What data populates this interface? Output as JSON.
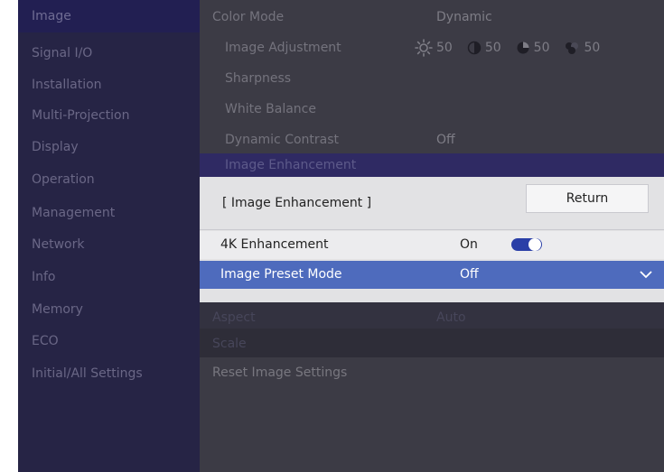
{
  "sidebar": {
    "items": [
      {
        "label": "Image"
      },
      {
        "label": "Signal I/O"
      },
      {
        "label": "Installation"
      },
      {
        "label": "Multi-Projection"
      },
      {
        "label": "Display"
      },
      {
        "label": "Operation"
      },
      {
        "label": "Management"
      },
      {
        "label": "Network"
      },
      {
        "label": "Info"
      },
      {
        "label": "Memory"
      },
      {
        "label": "ECO"
      },
      {
        "label": "Initial/All Settings"
      }
    ]
  },
  "menu": {
    "color_mode": {
      "label": "Color Mode",
      "value": "Dynamic"
    },
    "image_adjustment": {
      "label": "Image Adjustment",
      "values": [
        "50",
        "50",
        "50",
        "50"
      ]
    },
    "sharpness": {
      "label": "Sharpness"
    },
    "white_balance": {
      "label": "White Balance"
    },
    "dynamic_contrast": {
      "label": "Dynamic Contrast",
      "value": "Off"
    },
    "image_enhancement": {
      "label": "Image Enhancement"
    },
    "aspect": {
      "label": "Aspect",
      "value": "Auto"
    },
    "scale": {
      "label": "Scale"
    },
    "reset": {
      "label": "Reset Image Settings"
    }
  },
  "dialog": {
    "title": "[ Image Enhancement ]",
    "return_label": "Return",
    "rows": [
      {
        "label": "4K Enhancement",
        "value": "On",
        "toggle": true
      },
      {
        "label": "Image Preset Mode",
        "value": "Off"
      }
    ]
  }
}
